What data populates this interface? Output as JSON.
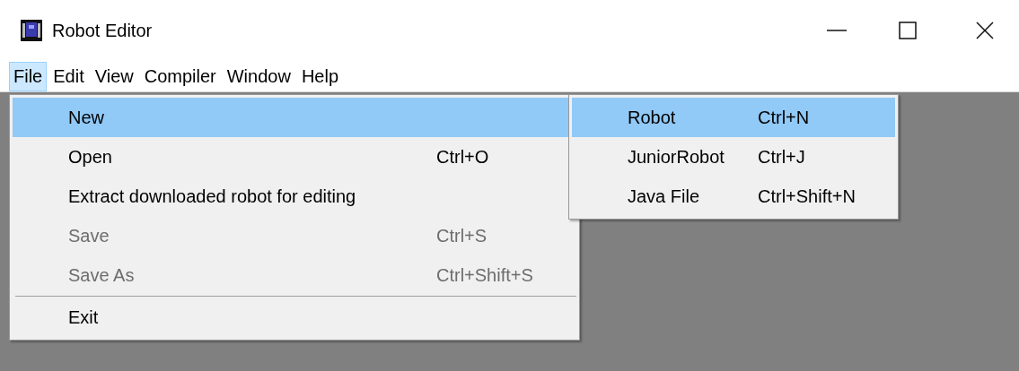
{
  "window": {
    "title": "Robot Editor"
  },
  "menubar": [
    {
      "label": "File",
      "selected": true
    },
    {
      "label": "Edit",
      "selected": false
    },
    {
      "label": "View",
      "selected": false
    },
    {
      "label": "Compiler",
      "selected": false
    },
    {
      "label": "Window",
      "selected": false
    },
    {
      "label": "Help",
      "selected": false
    }
  ],
  "file_menu": [
    {
      "kind": "item",
      "label": "New",
      "selected": true,
      "disabled": false
    },
    {
      "kind": "item",
      "label": "Open",
      "shortcut": "Ctrl+O",
      "selected": false,
      "disabled": false
    },
    {
      "kind": "item",
      "label": "Extract downloaded robot for editing",
      "selected": false,
      "disabled": false
    },
    {
      "kind": "item",
      "label": "Save",
      "shortcut": "Ctrl+S",
      "selected": false,
      "disabled": true
    },
    {
      "kind": "item",
      "label": "Save As",
      "shortcut": "Ctrl+Shift+S",
      "selected": false,
      "disabled": true
    },
    {
      "kind": "separator"
    },
    {
      "kind": "item",
      "label": "Exit",
      "selected": false,
      "disabled": false
    }
  ],
  "new_submenu": [
    {
      "label": "Robot",
      "shortcut": "Ctrl+N",
      "selected": true
    },
    {
      "label": "JuniorRobot",
      "shortcut": "Ctrl+J",
      "selected": false
    },
    {
      "label": "Java File",
      "shortcut": "Ctrl+Shift+N",
      "selected": false
    }
  ]
}
